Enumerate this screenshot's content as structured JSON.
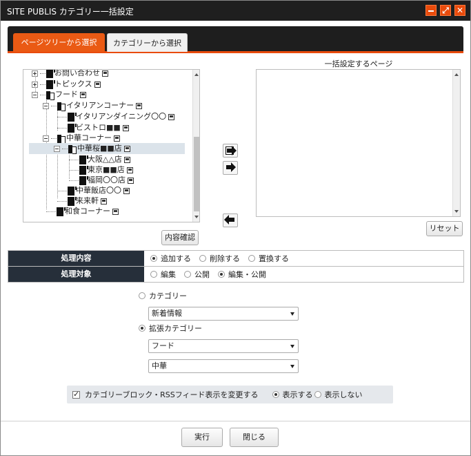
{
  "window": {
    "title": "SITE PUBLIS カテゴリー一括設定"
  },
  "tabs": [
    {
      "label": "ページツリーから選択",
      "active": true
    },
    {
      "label": "カテゴリーから選択",
      "active": false
    }
  ],
  "tree": {
    "items": [
      {
        "label": "お問い合わせ"
      },
      {
        "label": "トピックス"
      },
      {
        "label": "フード"
      },
      {
        "label": "イタリアンコーナー"
      },
      {
        "label": "イタリアンダイニング〇〇"
      },
      {
        "label": "ビストロ■■"
      },
      {
        "label": "中華コーナー"
      },
      {
        "label": "中華桜■■店"
      },
      {
        "label": "大阪△△店"
      },
      {
        "label": "東京■■店"
      },
      {
        "label": "福岡〇〇店"
      },
      {
        "label": "中華飯店〇〇"
      },
      {
        "label": "来来軒"
      },
      {
        "label": "和食コーナー"
      }
    ]
  },
  "right_panel": {
    "label": "一括設定するページ"
  },
  "buttons": {
    "confirm": "内容確認",
    "reset": "リセット",
    "execute": "実行",
    "close": "閉じる"
  },
  "process": {
    "label": "処理内容",
    "options": [
      "追加する",
      "削除する",
      "置換する"
    ],
    "selected": "追加する"
  },
  "target": {
    "label": "処理対象",
    "options": [
      "編集",
      "公開",
      "編集・公開"
    ],
    "selected": "編集・公開"
  },
  "category": {
    "label": "カテゴリー",
    "select_value": "新着情報"
  },
  "ext_category": {
    "label": "拡張カテゴリー",
    "select1_value": "フード",
    "select2_value": "中華"
  },
  "block": {
    "checkbox_label": "カテゴリーブロック・RSSフィード表示を変更する",
    "show_label": "表示する",
    "hide_label": "表示しない"
  },
  "colors": {
    "accent": "#ea5a14",
    "titlebar": "#1f1f1f",
    "header_dark": "#262f3a"
  }
}
